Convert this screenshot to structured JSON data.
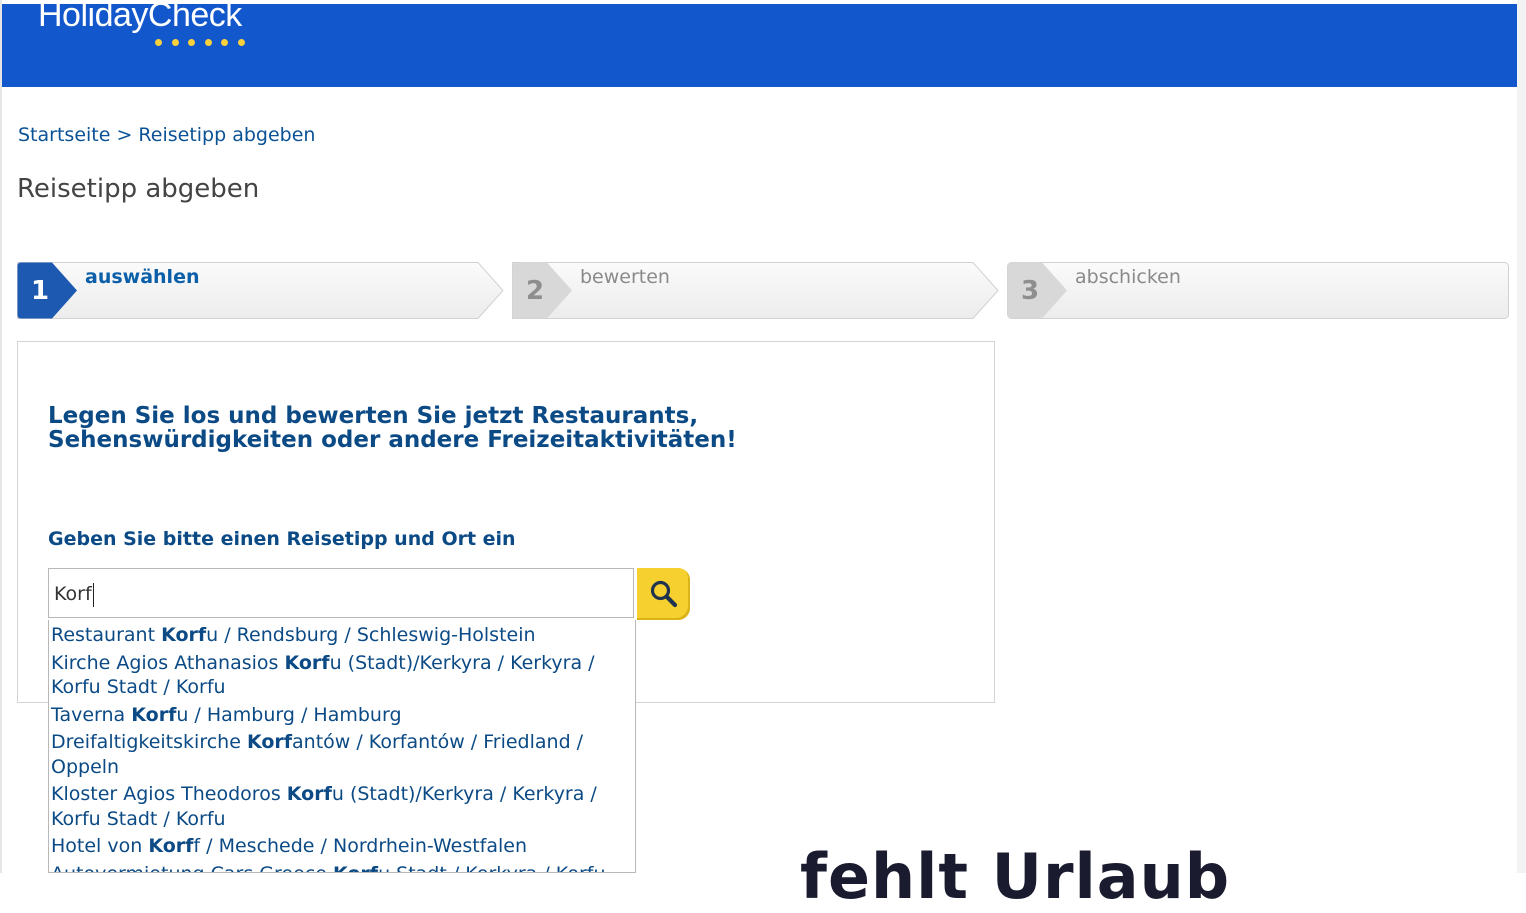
{
  "header": {
    "logo_text": "HolidayCheck",
    "brand_color": "#1257cc",
    "accent_color": "#f7d13b"
  },
  "breadcrumb": {
    "home": "Startseite",
    "separator": " > ",
    "current": "Reisetipp abgeben"
  },
  "page_title": "Reisetipp abgeben",
  "steps": [
    {
      "number": "1",
      "label": "auswählen",
      "active": true
    },
    {
      "number": "2",
      "label": "bewerten",
      "active": false
    },
    {
      "number": "3",
      "label": "abschicken",
      "active": false
    }
  ],
  "panel": {
    "heading": "Legen Sie los und bewerten Sie jetzt Restaurants, Sehenswürdigkeiten oder andere Freizeitaktivitäten!",
    "label": "Geben Sie bitte einen Reisetipp und Ort ein"
  },
  "search": {
    "value": "Korf",
    "button_icon": "search-icon"
  },
  "suggestions": [
    {
      "pre": "Restaurant ",
      "match": "Korf",
      "post": "u / Rendsburg / Schleswig-Holstein"
    },
    {
      "pre": "Kirche Agios Athanasios ",
      "match": "Korf",
      "post": "u (Stadt)/Kerkyra / Kerkyra / Korfu Stadt / Korfu"
    },
    {
      "pre": "Taverna ",
      "match": "Korf",
      "post": "u / Hamburg / Hamburg"
    },
    {
      "pre": "Dreifaltigkeitskirche ",
      "match": "Korf",
      "post": "antów / Korfantów / Friedland / Oppeln"
    },
    {
      "pre": "Kloster Agios Theodoros ",
      "match": "Korf",
      "post": "u (Stadt)/Kerkyra / Kerkyra / Korfu Stadt / Korfu"
    },
    {
      "pre": "Hotel von ",
      "match": "Korf",
      "post": "f / Meschede / Nordrhein-Westfalen"
    },
    {
      "pre": "Autovermietung Cars Greece ",
      "match": "Korf",
      "post": "u Stadt / Kerkyra / Korfu Stadt"
    }
  ],
  "background_text": "fehlt Urlaub"
}
